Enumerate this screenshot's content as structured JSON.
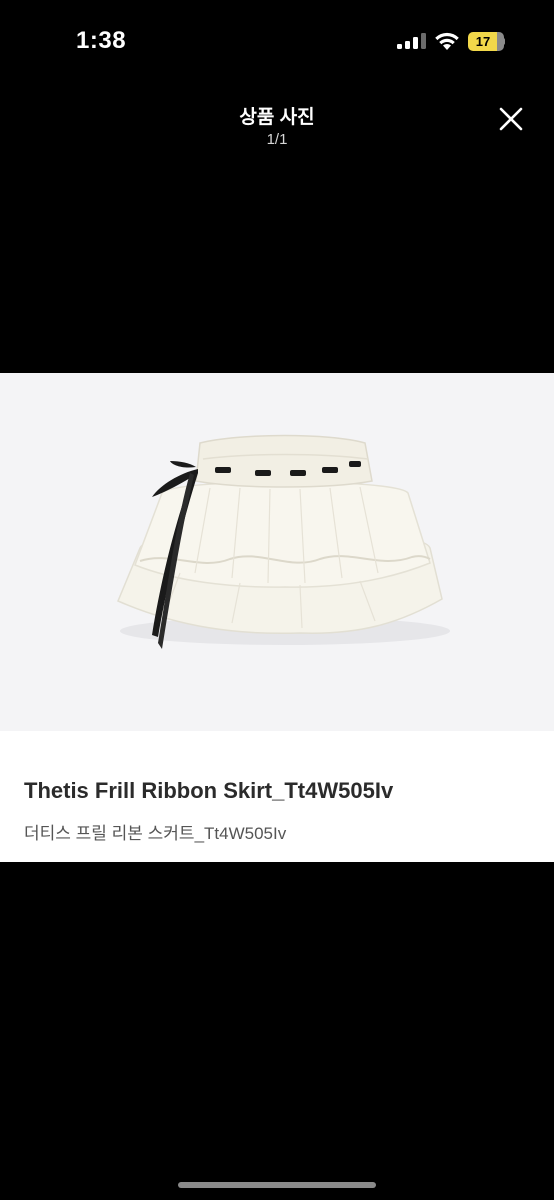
{
  "status_bar": {
    "time": "1:38",
    "battery_level": "17",
    "battery_color": "#f2d84a",
    "icons": [
      "signal-icon",
      "wifi-icon",
      "battery-icon"
    ]
  },
  "header": {
    "title": "상품 사진",
    "counter": "1/1",
    "close_icon": "close-icon"
  },
  "product": {
    "image_name": "white frill skirt with black ribbon",
    "title": "Thetis Frill Ribbon Skirt_Tt4W505Iv",
    "subtitle": "더티스 프릴 리본 스커트_Tt4W505Iv"
  },
  "colors": {
    "background": "#000000",
    "image_background": "#f4f4f6",
    "caption_background": "#ffffff"
  }
}
